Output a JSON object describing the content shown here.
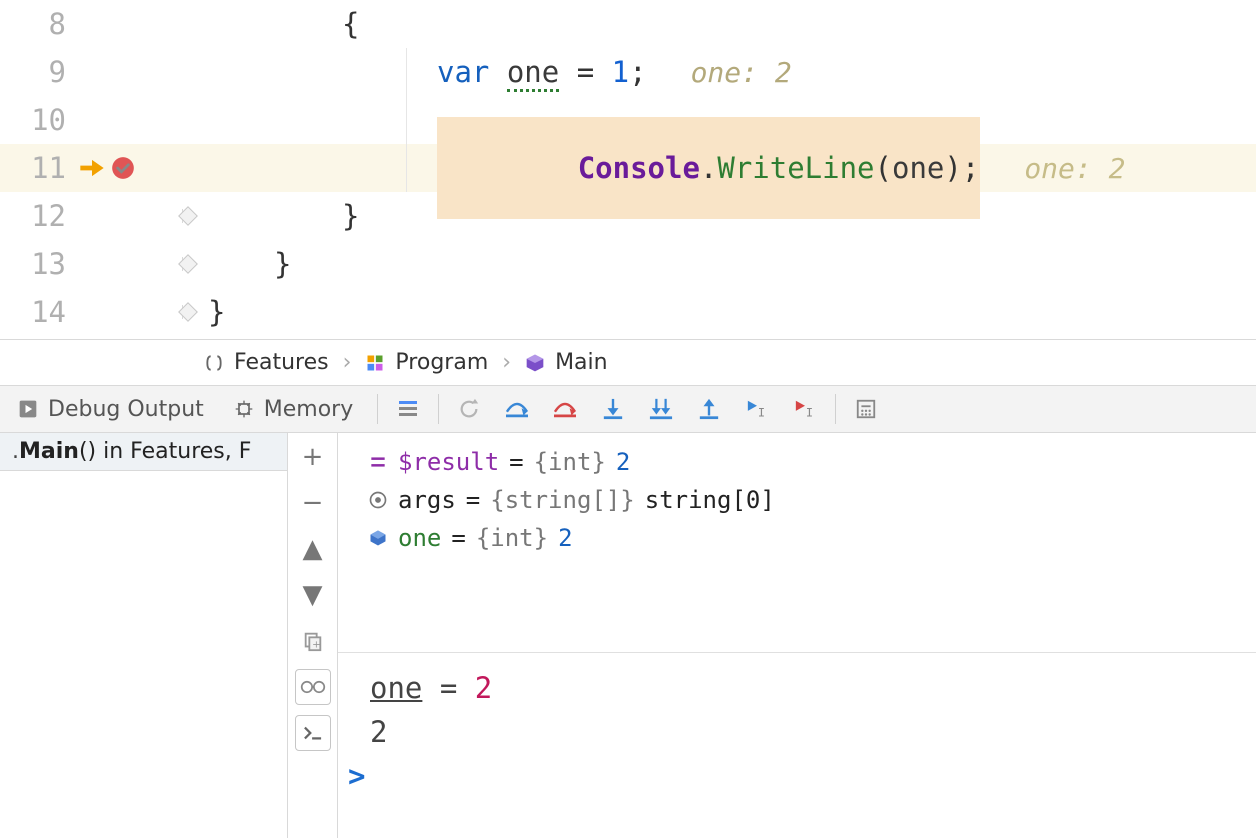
{
  "editor": {
    "lines": [
      {
        "num": "8"
      },
      {
        "num": "9",
        "hint": "one: 2"
      },
      {
        "num": "10"
      },
      {
        "num": "11",
        "hint": "one: 2"
      },
      {
        "num": "12"
      },
      {
        "num": "13"
      },
      {
        "num": "14"
      }
    ],
    "code": {
      "l8_brace": "{",
      "l9_var": "var ",
      "l9_ident": "one",
      "l9_assign": " = ",
      "l9_num": "1",
      "l9_semi": ";",
      "l11_class": "Console",
      "l11_dot": ".",
      "l11_method": "WriteLine",
      "l11_open": "(",
      "l11_arg": "one",
      "l11_close": ")",
      "l11_semi": ";",
      "l12_brace": "}",
      "l13_brace": "}",
      "l14_brace": "}"
    }
  },
  "breadcrumb": {
    "items": [
      "Features",
      "Program",
      "Main"
    ],
    "sep": "›"
  },
  "toolbar": {
    "tab_debug": "Debug Output",
    "tab_memory": "Memory"
  },
  "frames": {
    "active": ".Main() in Features, F"
  },
  "variables": [
    {
      "icon": "equals",
      "name": "$result",
      "eq": " = ",
      "type": "{int}",
      "value": " 2",
      "name_class": "c-purple"
    },
    {
      "icon": "param",
      "name": "args",
      "eq": " = ",
      "type": "{string[]}",
      "value": " string[0]",
      "name_class": ""
    },
    {
      "icon": "cube",
      "name": "one",
      "eq": " = ",
      "type": "{int}",
      "value": " 2",
      "name_class": "c-green"
    }
  ],
  "console": {
    "expr_lhs": "one",
    "expr_eq": " = ",
    "expr_rhs": "2",
    "result": "2",
    "prompt": ">"
  }
}
